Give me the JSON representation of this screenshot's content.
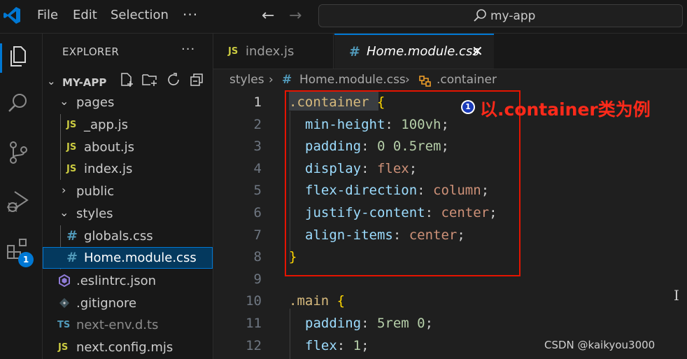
{
  "titlebar": {
    "menu": [
      "File",
      "Edit",
      "Selection"
    ],
    "more": "···",
    "back": "←",
    "forward": "→",
    "search_text": "my-app"
  },
  "activitybar": {
    "icons": [
      "explorer-icon",
      "search-icon",
      "source-control-icon",
      "run-debug-icon",
      "extensions-icon"
    ],
    "badge": "1"
  },
  "sidebar": {
    "title": "EXPLORER",
    "more": "···",
    "folder": "MY-APP",
    "items": [
      {
        "label": "pages",
        "chevron": "⌄",
        "kind": "folder"
      },
      {
        "label": "_app.js",
        "icon": "JS",
        "kind": "js"
      },
      {
        "label": "about.js",
        "icon": "JS",
        "kind": "js"
      },
      {
        "label": "index.js",
        "icon": "JS",
        "kind": "js"
      },
      {
        "label": "public",
        "chevron": "›",
        "kind": "folder"
      },
      {
        "label": "styles",
        "chevron": "⌄",
        "kind": "folder"
      },
      {
        "label": "globals.css",
        "icon": "#",
        "kind": "css"
      },
      {
        "label": "Home.module.css",
        "icon": "#",
        "kind": "css",
        "selected": true
      },
      {
        "label": ".eslintrc.json",
        "kind": "eslint"
      },
      {
        "label": ".gitignore",
        "kind": "git"
      },
      {
        "label": "next-env.d.ts",
        "icon": "TS",
        "kind": "ts"
      },
      {
        "label": "next.config.mjs",
        "icon": "JS",
        "kind": "js"
      }
    ]
  },
  "tabs": [
    {
      "label": "index.js",
      "icon": "JS",
      "active": false
    },
    {
      "label": "Home.module.css",
      "icon": "#",
      "active": true,
      "close": "✕"
    }
  ],
  "breadcrumb": {
    "folder": "styles",
    "sep": "›",
    "file_icon": "#",
    "file": "Home.module.css",
    "symbol": ".container"
  },
  "editor": {
    "lines": [
      {
        "n": "1",
        "tokens": [
          {
            "t": ".container",
            "c": "sel"
          },
          {
            "t": " ",
            "c": "punc"
          },
          {
            "t": "{",
            "c": "brace"
          }
        ]
      },
      {
        "n": "2",
        "tokens": [
          {
            "t": "min-height",
            "c": "prop"
          },
          {
            "t": ": ",
            "c": "punc"
          },
          {
            "t": "100vh",
            "c": "num"
          },
          {
            "t": ";",
            "c": "punc"
          }
        ]
      },
      {
        "n": "3",
        "tokens": [
          {
            "t": "padding",
            "c": "prop"
          },
          {
            "t": ": ",
            "c": "punc"
          },
          {
            "t": "0 0.5rem",
            "c": "num"
          },
          {
            "t": ";",
            "c": "punc"
          }
        ]
      },
      {
        "n": "4",
        "tokens": [
          {
            "t": "display",
            "c": "prop"
          },
          {
            "t": ": ",
            "c": "punc"
          },
          {
            "t": "flex",
            "c": "val"
          },
          {
            "t": ";",
            "c": "punc"
          }
        ]
      },
      {
        "n": "5",
        "tokens": [
          {
            "t": "flex-direction",
            "c": "prop"
          },
          {
            "t": ": ",
            "c": "punc"
          },
          {
            "t": "column",
            "c": "val"
          },
          {
            "t": ";",
            "c": "punc"
          }
        ]
      },
      {
        "n": "6",
        "tokens": [
          {
            "t": "justify-content",
            "c": "prop"
          },
          {
            "t": ": ",
            "c": "punc"
          },
          {
            "t": "center",
            "c": "val"
          },
          {
            "t": ";",
            "c": "punc"
          }
        ]
      },
      {
        "n": "7",
        "tokens": [
          {
            "t": "align-items",
            "c": "prop"
          },
          {
            "t": ": ",
            "c": "punc"
          },
          {
            "t": "center",
            "c": "val"
          },
          {
            "t": ";",
            "c": "punc"
          }
        ]
      },
      {
        "n": "8",
        "tokens": [
          {
            "t": "}",
            "c": "brace"
          }
        ]
      },
      {
        "n": "9",
        "tokens": []
      },
      {
        "n": "10",
        "tokens": [
          {
            "t": ".main",
            "c": "sel"
          },
          {
            "t": " ",
            "c": "punc"
          },
          {
            "t": "{",
            "c": "brace"
          }
        ]
      },
      {
        "n": "11",
        "tokens": [
          {
            "t": "padding",
            "c": "prop"
          },
          {
            "t": ": ",
            "c": "punc"
          },
          {
            "t": "5rem 0",
            "c": "num"
          },
          {
            "t": ";",
            "c": "punc"
          }
        ]
      },
      {
        "n": "12",
        "tokens": [
          {
            "t": "flex",
            "c": "prop"
          },
          {
            "t": ": ",
            "c": "punc"
          },
          {
            "t": "1",
            "c": "num"
          },
          {
            "t": ";",
            "c": "punc"
          }
        ]
      }
    ]
  },
  "annotation": {
    "badge": "1",
    "text": "以.container类为例"
  },
  "cursor": "I",
  "watermark": "CSDN @kaikyou3000",
  "colors": {
    "accent": "#0078d4",
    "annotation_red": "#e51400",
    "js": "#cbcb41",
    "css": "#519aba"
  }
}
